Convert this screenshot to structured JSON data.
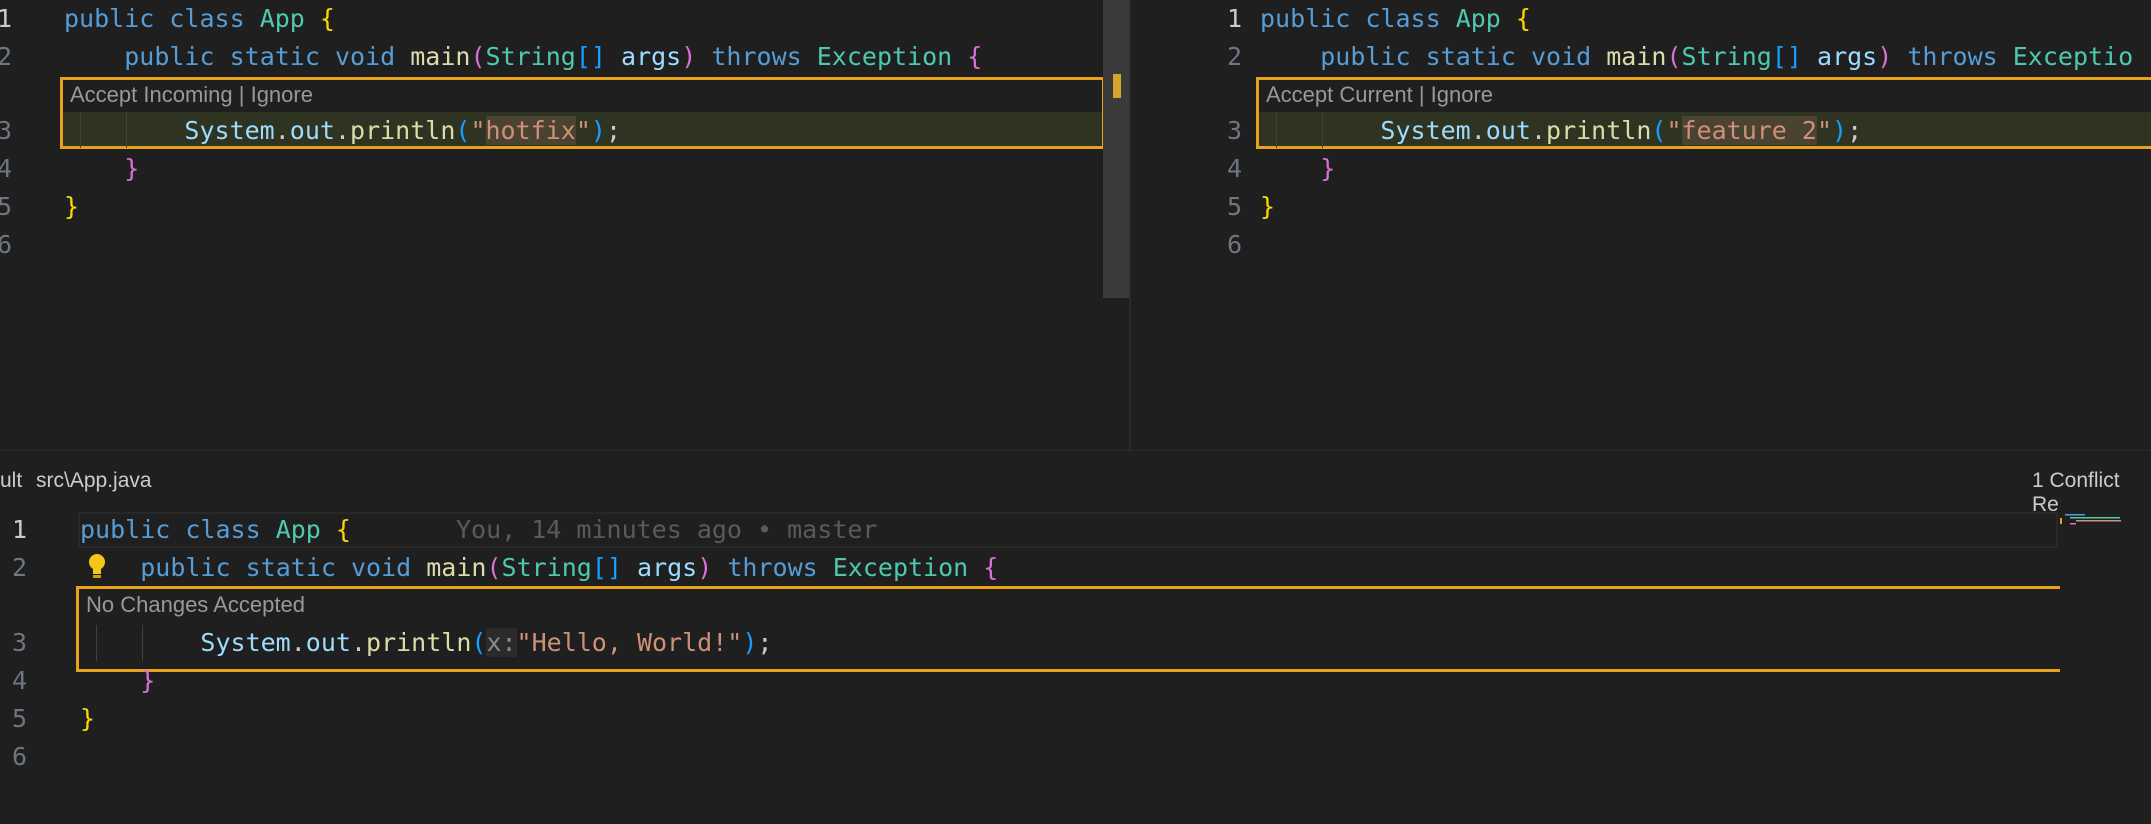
{
  "incoming": {
    "lines": [
      "1",
      "2",
      "3",
      "4",
      "5",
      "6"
    ],
    "codelens": "Accept Incoming | Ignore",
    "code": {
      "l1": {
        "kw1": "public",
        "kw2": "class",
        "cls": "App",
        "brace": "{"
      },
      "l2": {
        "kw1": "public",
        "kw2": "static",
        "kw3": "void",
        "fn": "main",
        "p1": "(",
        "type": "String",
        "arr": "[]",
        "arg": "args",
        "p2": ")",
        "throws": "throws",
        "exc": "Exception",
        "brace": "{"
      },
      "l3": {
        "obj": "System",
        "dot1": ".",
        "out": "out",
        "dot2": ".",
        "fn": "println",
        "p1": "(",
        "q1": "\"",
        "str": "hotfix",
        "q2": "\"",
        "p2": ")",
        "semi": ";"
      },
      "l4": "}",
      "l5": "}"
    }
  },
  "current": {
    "lines": [
      "1",
      "2",
      "3",
      "4",
      "5",
      "6"
    ],
    "codelens": "Accept Current | Ignore",
    "code": {
      "l1": {
        "kw1": "public",
        "kw2": "class",
        "cls": "App",
        "brace": "{"
      },
      "l2": {
        "kw1": "public",
        "kw2": "static",
        "kw3": "void",
        "fn": "main",
        "p1": "(",
        "type": "String",
        "arr": "[]",
        "arg": "args",
        "p2": ")",
        "throws": "throws",
        "exc": "Exceptio"
      },
      "l3": {
        "obj": "System",
        "dot1": ".",
        "out": "out",
        "dot2": ".",
        "fn": "println",
        "p1": "(",
        "q1": "\"",
        "str": "feature 2",
        "q2": "\"",
        "p2": ")",
        "semi": ";"
      },
      "l4": "}",
      "l5": "}"
    }
  },
  "result": {
    "header_left": "ult",
    "file_path": "src\\App.java",
    "conflict_count": "1 Conflict Re",
    "lines": [
      "1",
      "2",
      "3",
      "4",
      "5",
      "6"
    ],
    "blame": "You, 14 minutes ago • master",
    "codelens": "No Changes Accepted",
    "code": {
      "l1": {
        "kw1": "public",
        "kw2": "class",
        "cls": "App",
        "brace": "{"
      },
      "l2": {
        "kw1": "public",
        "kw2": "static",
        "kw3": "void",
        "fn": "main",
        "p1": "(",
        "type": "String",
        "arr": "[]",
        "arg": "args",
        "p2": ")",
        "throws": "throws",
        "exc": "Exception",
        "brace": "{"
      },
      "l3": {
        "obj": "System",
        "dot1": ".",
        "out": "out",
        "dot2": ".",
        "fn": "println",
        "p1": "(",
        "hint": "x:",
        "str": "\"Hello, World!\"",
        "p2": ")",
        "semi": ";"
      },
      "l4": "}",
      "l5": "}"
    }
  },
  "icons": {
    "bulb": "lightbulb-icon"
  },
  "colors": {
    "conflict_border": "#e6a21a",
    "background": "#1f1f1f"
  }
}
